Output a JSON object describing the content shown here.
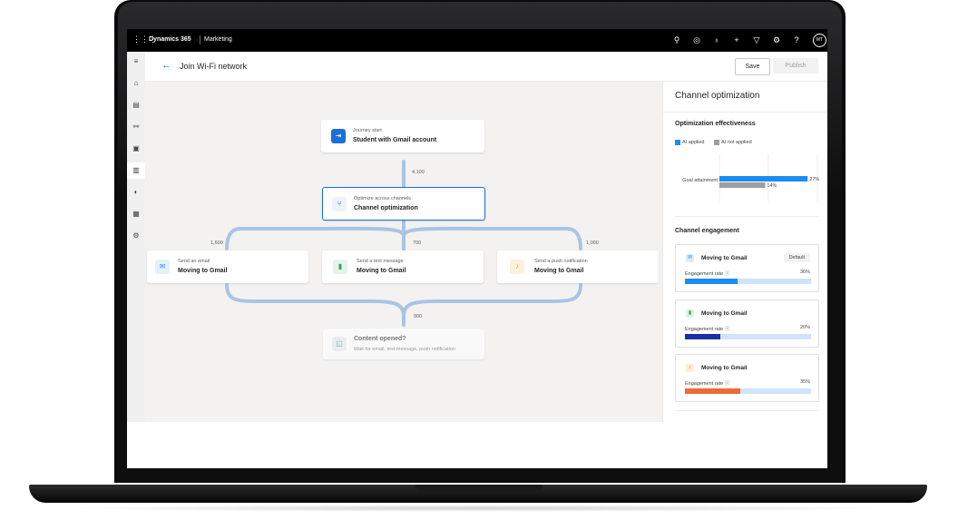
{
  "app": {
    "name": "Dynamics 365",
    "area": "Marketing",
    "user_initials": "MT"
  },
  "topbar_icons": [
    "search-icon",
    "target-icon",
    "lightbulb-icon",
    "plus-icon",
    "filter-icon",
    "settings-icon",
    "help-icon"
  ],
  "nav_icons": [
    "hamburger-icon",
    "home-icon",
    "clipboard-icon",
    "flow-icon",
    "document-icon",
    "chart-icon",
    "globe-icon",
    "map-icon",
    "settings-icon"
  ],
  "header": {
    "title": "Join Wi-Fi network",
    "save_label": "Save",
    "publish_label": "Publish"
  },
  "journey": {
    "start": {
      "subtitle": "Journey start",
      "title": "Student with Gmail account"
    },
    "count_to_optimize": "4,100",
    "optimize": {
      "subtitle": "Optimize across channels",
      "title": "Channel optimization"
    },
    "branch_counts": [
      "1,600",
      "700",
      "1,000"
    ],
    "branches": [
      {
        "subtitle": "Send an email",
        "title": "Moving to Gmail",
        "icon": "mail-icon",
        "color": "#2f8cf0",
        "bg": "#e3f0fd"
      },
      {
        "subtitle": "Send a text message",
        "title": "Moving to Gmail",
        "icon": "text-message-icon",
        "color": "#3aa35a",
        "bg": "#e5f4e9"
      },
      {
        "subtitle": "Send a push notification",
        "title": "Moving to Gmail",
        "icon": "bell-icon",
        "color": "#f0a623",
        "bg": "#fdf1dc"
      }
    ],
    "merge_count": "900",
    "condition": {
      "title": "Content opened?",
      "subtitle": "Wait for email, text message, push notification"
    }
  },
  "panel": {
    "title": "Channel optimization",
    "effectiveness": {
      "title": "Optimization effectiveness",
      "legend_applied": "AI applied",
      "legend_not_applied": "AI not applied",
      "colors": {
        "applied": "#1b8cf0",
        "not_applied": "#9e9e9e"
      }
    },
    "engagement": {
      "title": "Channel engagement",
      "default_tag": "Default",
      "rate_label": "Engagement rate",
      "cards": [
        {
          "name": "Moving to Gmail",
          "value": "36%",
          "fraction": 0.42,
          "color": "#1b8cf0",
          "icon": "mail-icon",
          "icon_bg": "#d9ebfc",
          "icon_color": "#2f8cf0",
          "default": true
        },
        {
          "name": "Moving to Gmail",
          "value": "20%",
          "fraction": 0.28,
          "color": "#1a2fa6",
          "icon": "text-message-icon",
          "icon_bg": "#dff2e4",
          "icon_color": "#3aa35a",
          "default": false
        },
        {
          "name": "Moving to Gmail",
          "value": "35%",
          "fraction": 0.44,
          "color": "#ee6a37",
          "icon": "bell-icon",
          "icon_bg": "#fdecd2",
          "icon_color": "#f0a623",
          "default": false
        }
      ]
    }
  },
  "chart_data": {
    "type": "bar",
    "categories": [
      "Goal attainment"
    ],
    "series": [
      {
        "name": "AI applied",
        "values": [
          27
        ]
      },
      {
        "name": "AI not applied",
        "values": [
          14
        ]
      }
    ],
    "value_labels": [
      "27%",
      "14%"
    ],
    "xticks": [
      "0",
      "15%",
      "30%"
    ],
    "xlim": [
      0,
      30
    ],
    "orientation": "horizontal",
    "grid": true,
    "legend": "top-left"
  }
}
